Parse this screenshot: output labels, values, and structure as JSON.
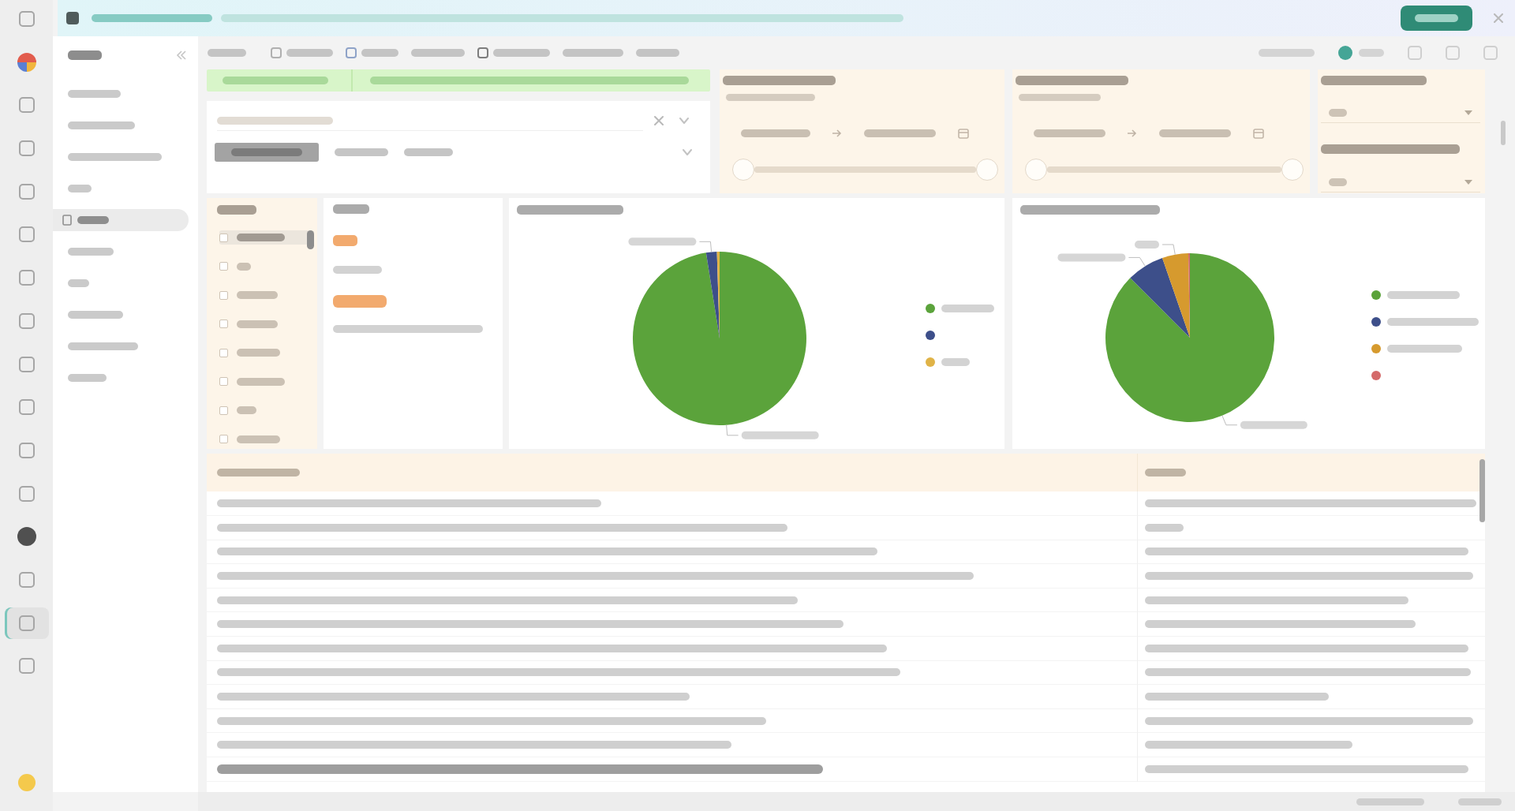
{
  "rail": {
    "items": [
      {
        "kind": "tool",
        "selected": false
      },
      {
        "kind": "logo",
        "selected": false
      },
      {
        "kind": "tool",
        "selected": false
      },
      {
        "kind": "tool",
        "selected": false
      },
      {
        "kind": "tool",
        "selected": false
      },
      {
        "kind": "tool",
        "selected": false
      },
      {
        "kind": "tool",
        "selected": false
      },
      {
        "kind": "tool",
        "selected": false
      },
      {
        "kind": "tool",
        "selected": false
      },
      {
        "kind": "tool",
        "selected": false
      },
      {
        "kind": "tool",
        "selected": false
      },
      {
        "kind": "tool",
        "selected": false
      },
      {
        "kind": "avatar",
        "selected": false
      },
      {
        "kind": "tool",
        "selected": false
      },
      {
        "kind": "tool",
        "selected": true
      },
      {
        "kind": "tool",
        "selected": false
      },
      {
        "kind": "tip",
        "selected": false
      }
    ]
  },
  "banner": {
    "title": true,
    "message": true,
    "button": {
      "label": true
    }
  },
  "pages": {
    "heading": true,
    "items": [
      {
        "label": true,
        "selected": false
      },
      {
        "label": true,
        "selected": false
      },
      {
        "label": true,
        "selected": false
      },
      {
        "label": true,
        "selected": false
      },
      {
        "label": true,
        "selected": true
      },
      {
        "label": true,
        "selected": false
      },
      {
        "label": true,
        "selected": false
      },
      {
        "label": true,
        "selected": false
      },
      {
        "label": true,
        "selected": false
      },
      {
        "label": true,
        "selected": false
      }
    ]
  },
  "toolbar": {
    "left": [
      {
        "label": true,
        "icon": false
      },
      {
        "label": true,
        "icon": true
      },
      {
        "label": true,
        "icon": true
      },
      {
        "label": true,
        "icon": false
      },
      {
        "label": true,
        "icon": true
      },
      {
        "label": true,
        "icon": false
      },
      {
        "label": true,
        "icon": false
      }
    ],
    "right": [
      {
        "kind": "text",
        "label": true
      },
      {
        "kind": "user",
        "label": true
      },
      {
        "kind": "icon"
      },
      {
        "kind": "icon"
      },
      {
        "kind": "icon"
      }
    ]
  },
  "notice": {
    "status": true,
    "message": true
  },
  "filter": {
    "search": {
      "placeholder": true
    },
    "chips": [
      {
        "label": true,
        "selected": true
      },
      {
        "label": true,
        "selected": false
      },
      {
        "label": true,
        "selected": false
      }
    ]
  },
  "date_ranges": [
    {
      "title": true,
      "subtitle": true,
      "start": {
        "value": true
      },
      "end": {
        "value": true
      },
      "handles": [
        {
          "level": 0
        },
        {
          "level": 1
        }
      ]
    },
    {
      "title": true,
      "subtitle": true,
      "start": {
        "value": true
      },
      "end": {
        "value": true
      },
      "handles": [
        {
          "level": 0
        },
        {
          "level": 1
        }
      ]
    }
  ],
  "dropdowns": [
    {
      "title": true,
      "value": true
    },
    {
      "title": true,
      "value": true
    }
  ],
  "list": {
    "title": true,
    "items": [
      {
        "label": true,
        "checked": false,
        "highlighted": true
      },
      {
        "label": true,
        "checked": false,
        "highlighted": false
      },
      {
        "label": true,
        "checked": false,
        "highlighted": false
      },
      {
        "label": true,
        "checked": false,
        "highlighted": false
      },
      {
        "label": true,
        "checked": false,
        "highlighted": false
      },
      {
        "label": true,
        "checked": false,
        "highlighted": false
      },
      {
        "label": true,
        "checked": false,
        "highlighted": false
      },
      {
        "label": true,
        "checked": false,
        "highlighted": false
      }
    ]
  },
  "totals": {
    "title": true,
    "metrics": [
      {
        "value": true,
        "caption": true
      },
      {
        "value": true,
        "caption": true
      }
    ]
  },
  "pies": [
    {
      "title": true,
      "chart_data": {
        "type": "pie",
        "values": [
          97.5,
          2.0,
          0.5
        ]
      },
      "slice_labels": [
        true,
        true,
        false
      ],
      "legend": [
        {
          "color": "#5ba33b",
          "label": true
        },
        {
          "color": "#3d4f8a"
        },
        {
          "color": "#e0b347",
          "label": true
        }
      ]
    },
    {
      "title": true,
      "chart_data": {
        "type": "pie",
        "values": [
          87.5,
          7.2,
          5.0,
          0.3
        ]
      },
      "slice_labels": [
        true,
        true,
        true,
        false
      ],
      "legend": [
        {
          "color": "#5ba33b",
          "label": true
        },
        {
          "color": "#3d4f8a",
          "label": true
        },
        {
          "color": "#d69a2e",
          "label": true
        },
        {
          "color": "#d46a6a"
        }
      ]
    }
  ],
  "table": {
    "columns": [
      true,
      true
    ],
    "rows": [
      {
        "cells": [
          true,
          true
        ],
        "highlighted": false
      },
      {
        "cells": [
          true,
          true
        ],
        "highlighted": false
      },
      {
        "cells": [
          true,
          true
        ],
        "highlighted": false
      },
      {
        "cells": [
          true,
          true
        ],
        "highlighted": false
      },
      {
        "cells": [
          true,
          true
        ],
        "highlighted": false
      },
      {
        "cells": [
          true,
          true
        ],
        "highlighted": false
      },
      {
        "cells": [
          true,
          true
        ],
        "highlighted": false
      },
      {
        "cells": [
          true,
          true
        ],
        "highlighted": false
      },
      {
        "cells": [
          true,
          true
        ],
        "highlighted": false
      },
      {
        "cells": [
          true,
          true
        ],
        "highlighted": false
      },
      {
        "cells": [
          true,
          true
        ],
        "highlighted": false
      },
      {
        "cells": [
          true,
          true
        ],
        "highlighted": true
      }
    ]
  },
  "status_bar": {
    "items": [
      true,
      true
    ]
  }
}
